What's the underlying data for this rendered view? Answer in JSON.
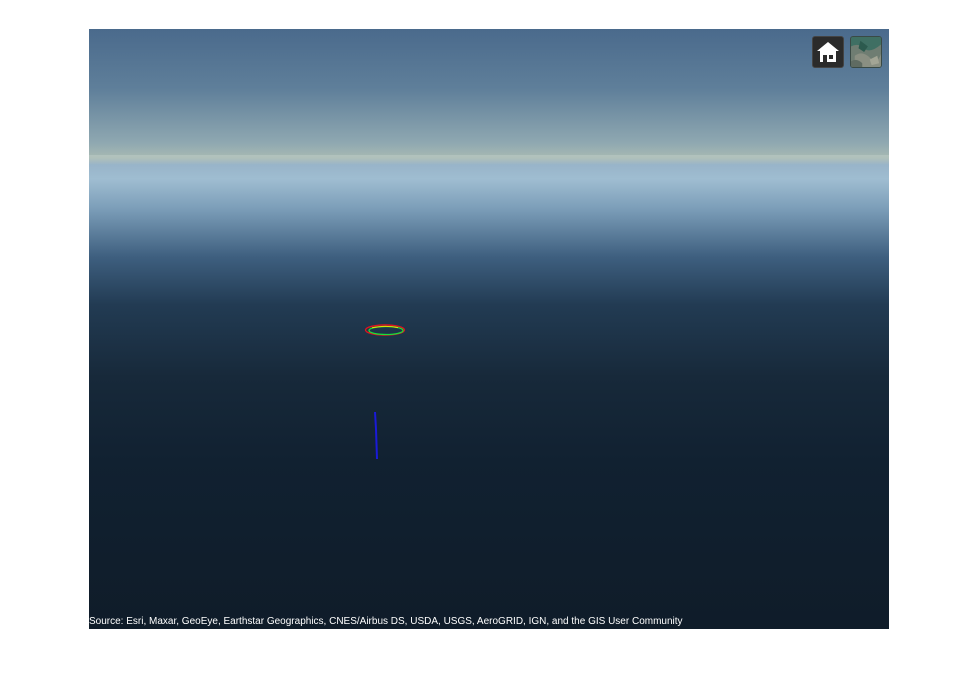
{
  "viewer": {
    "attribution": "Source: Esri, Maxar, GeoEye, Earthstar Geographics, CNES/Airbus DS, USDA, USGS, AeroGRID, IGN, and the GIS User Community"
  },
  "toolbar": {
    "home_icon": "home-icon",
    "basemap_icon": "basemap-imagery-icon"
  },
  "colors": {
    "orbit_red": "#e0141e",
    "orbit_green": "#18e03a",
    "orbit_yellow": "#e8e000",
    "track_blue": "#1a1ad8"
  }
}
